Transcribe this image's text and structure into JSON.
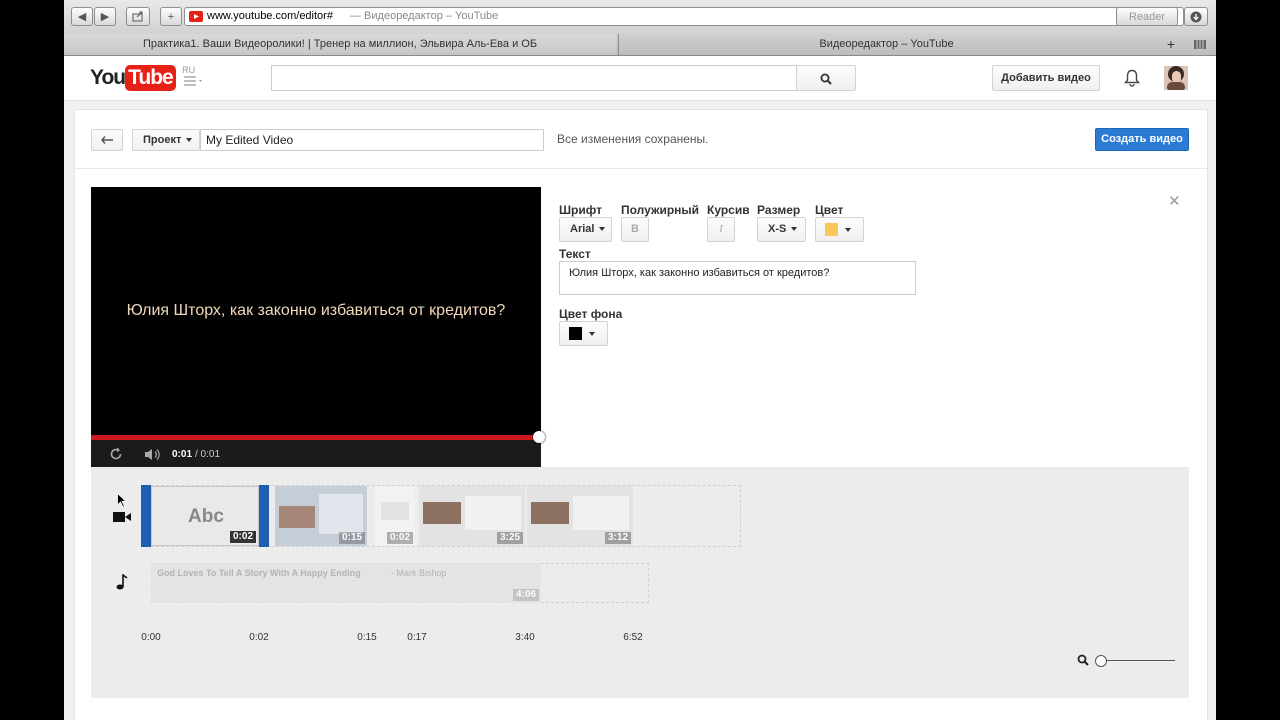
{
  "browser": {
    "back_icon": "◀",
    "forward_icon": "▶",
    "url": "www.youtube.com/editor#",
    "page_title_suffix": "— Видеоредактор – YouTube",
    "reader_label": "Reader",
    "tabs": [
      {
        "label": "Практика1. Ваши Видеоролики! | Тренер на миллион, Эльвира Аль-Ева и ОБ"
      },
      {
        "label": "Видеоредактор – YouTube"
      }
    ]
  },
  "header": {
    "logo_you": "You",
    "logo_tube": "Tube",
    "logo_region": "RU",
    "search_placeholder": "",
    "add_video_label": "Добавить видео"
  },
  "editor_bar": {
    "project_label": "Проект",
    "project_name": "My Edited Video",
    "saved_status": "Все изменения сохранены.",
    "create_button": "Создать видео"
  },
  "preview": {
    "caption": "Юлия Шторх, как законно избавиться от кредитов?",
    "time_current": "0:01",
    "time_total": "/ 0:01",
    "progress": 1.0
  },
  "text_settings": {
    "font_label": "Шрифт",
    "font_value": "Arial",
    "bold_label": "Полужирный",
    "bold_icon": "B",
    "italic_label": "Курсив",
    "italic_icon": "I",
    "size_label": "Размер",
    "size_value": "X-S",
    "color_label": "Цвет",
    "color_value": "#f9c85a",
    "text_label": "Текст",
    "text_value": "Юлия Шторх, как законно избавиться от кредитов?",
    "bg_label": "Цвет фона",
    "bg_value": "#000000",
    "close_icon": "✕"
  },
  "timeline": {
    "video_clips": [
      {
        "label": "Abc",
        "duration": "0:02"
      },
      {
        "label": "",
        "duration": "0:15"
      },
      {
        "label": "",
        "duration": "0:02"
      },
      {
        "label": "",
        "duration": "3:25"
      },
      {
        "label": "",
        "duration": "3:12"
      }
    ],
    "audio_track": {
      "title": "God Loves To Tell A Story With A Happy Ending",
      "artist": "- Mark Bishop",
      "duration": "4:06"
    },
    "ticks": [
      "0:00",
      "0:02",
      "0:15",
      "0:17",
      "3:40",
      "6:52"
    ]
  },
  "colors": {
    "youtube_red": "#e62117",
    "create_blue": "#2b7bd4",
    "progress_red": "#cc181e"
  }
}
